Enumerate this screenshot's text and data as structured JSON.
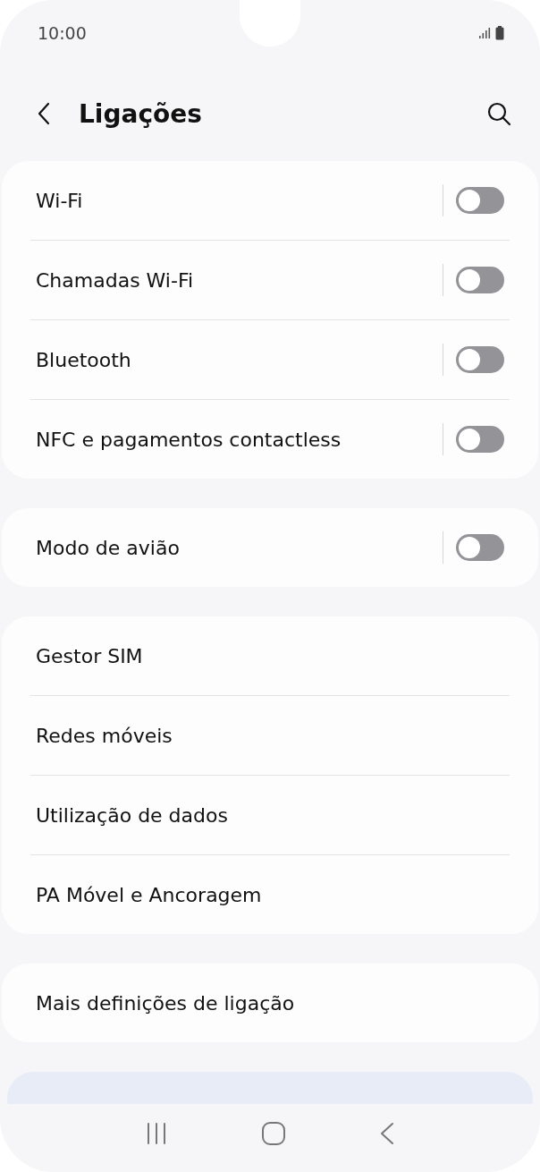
{
  "status_bar": {
    "time": "10:00"
  },
  "header": {
    "title": "Ligações"
  },
  "groups": [
    {
      "items": [
        {
          "label": "Wi-Fi",
          "kind": "toggle",
          "on": false
        },
        {
          "label": "Chamadas Wi-Fi",
          "kind": "toggle",
          "on": false
        },
        {
          "label": "Bluetooth",
          "kind": "toggle",
          "on": false
        },
        {
          "label": "NFC e pagamentos contactless",
          "kind": "toggle",
          "on": false
        }
      ]
    },
    {
      "items": [
        {
          "label": "Modo de avião",
          "kind": "toggle",
          "on": false
        }
      ]
    },
    {
      "items": [
        {
          "label": "Gestor SIM",
          "kind": "link"
        },
        {
          "label": "Redes móveis",
          "kind": "link"
        },
        {
          "label": "Utilização de dados",
          "kind": "link"
        },
        {
          "label": "PA Móvel e Ancoragem",
          "kind": "link"
        }
      ]
    },
    {
      "items": [
        {
          "label": "Mais definições de ligação",
          "kind": "link"
        }
      ]
    }
  ]
}
